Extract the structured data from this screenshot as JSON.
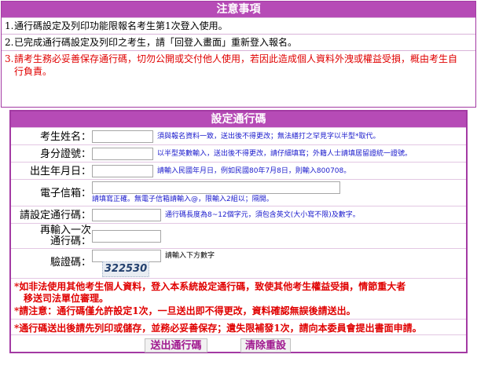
{
  "notice": {
    "title": "注意事項",
    "items": [
      {
        "num": "1.",
        "text": "通行碼設定及列印功能限報名考生第1次登入使用。"
      },
      {
        "num": "2.",
        "text": "已完成通行碼設定及列印之考生，請「回登入畫面」重新登入報名。"
      },
      {
        "num": "3.",
        "text": "請考生務必妥善保存通行碼，切勿公開或交付他人使用，若因此造成個人資料外洩或權益受損，概由考生自行負責。"
      }
    ]
  },
  "form": {
    "title": "設定通行碼",
    "fields": {
      "name": {
        "label": "考生姓名：",
        "hint": "須與報名資料一致，送出後不得更改；無法繕打之罕見字以半型*取代。"
      },
      "id": {
        "label": "身分證號：",
        "hint": "以半型英數輸入，送出後不得更改，請仔細填寫；外籍人士請填居留證統一證號。"
      },
      "birth": {
        "label": "出生年月日：",
        "hint": "請輸入民國年月日，例如民國80年7月8日，則輸入800708。"
      },
      "email": {
        "label": "電子信箱：",
        "hint": "請填寫正確。無電子信箱請輸入@，限輸入2組以；隔開。"
      },
      "password": {
        "label": "請設定通行碼：",
        "hint": "通行碼長度為8~12個字元，須包含英文(大小寫不限)及數字。"
      },
      "confirm": {
        "label_line1": "再輸入一次",
        "label_line2": "通行碼："
      },
      "captcha": {
        "label": "驗證碼：",
        "hint": "請輸入下方數字",
        "code": "322530"
      }
    },
    "warnings": {
      "w1_line1": "*如非法使用其他考生個人資料，登入本系統設定通行碼，致使其他考生權益受損，情節重大者",
      "w1_line2": "移送司法單位審理。",
      "w2": "*請注意：通行碼僅允許設定1次，一旦送出即不得更改，資料確認無誤後請送出。",
      "w3": "*通行碼送出後請先列印或儲存，並務必妥善保存；遺失限補發1次，請向本委員會提出書面申請。"
    },
    "buttons": {
      "submit": "送出通行碼",
      "reset": "清除重設"
    }
  },
  "colors": {
    "header_bg": "#b64bb6",
    "border": "#a33aa3",
    "warning_text": "#e00000",
    "hint_text": "#1a1acc"
  }
}
